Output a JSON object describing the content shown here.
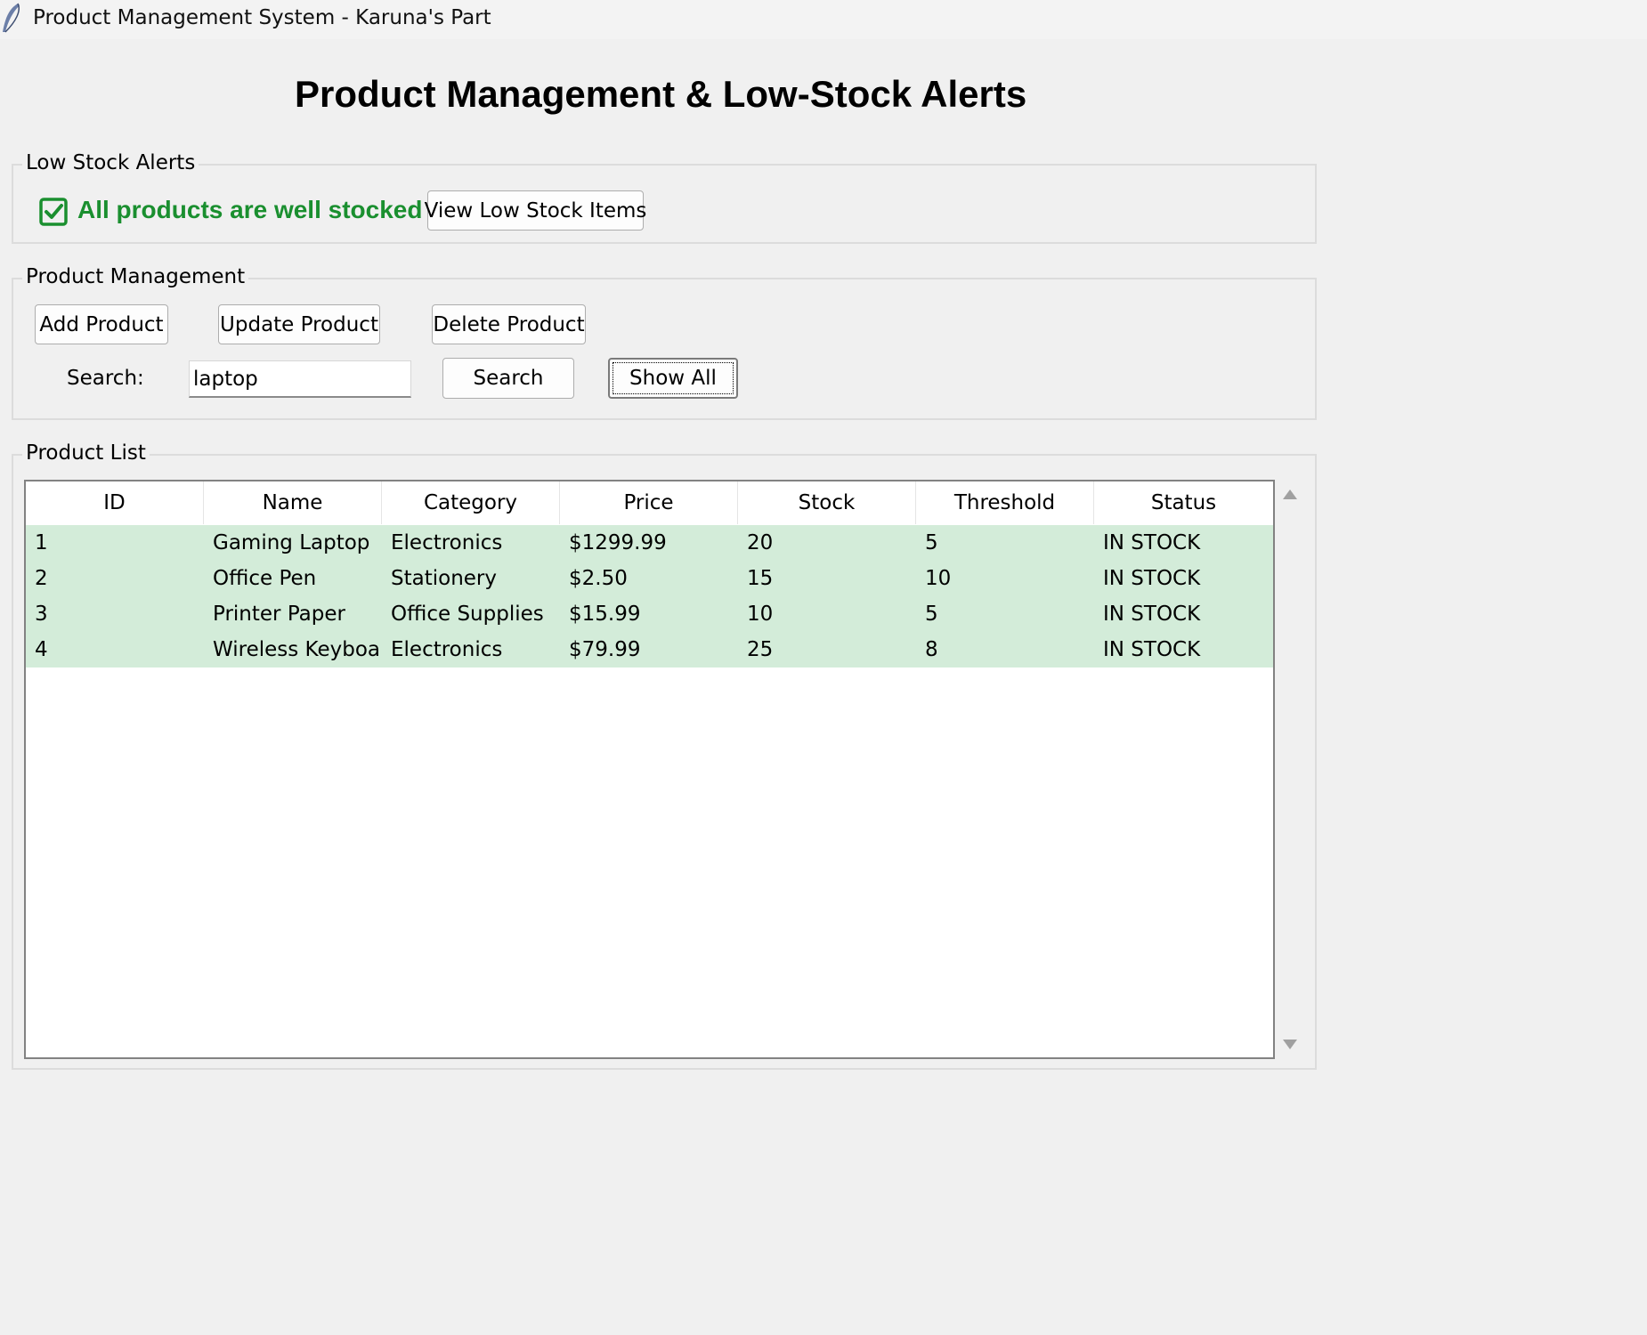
{
  "window": {
    "title": "Product Management System - Karuna's Part",
    "icon": "feather-icon"
  },
  "heading": "Product Management & Low-Stock Alerts",
  "low_stock": {
    "legend": "Low Stock Alerts",
    "status_icon": "check-box-icon",
    "status_text": "All products are well stocked",
    "status_color": "#1a8f2f",
    "view_button": "View Low Stock Items"
  },
  "management": {
    "legend": "Product Management",
    "add_button": "Add Product",
    "update_button": "Update Product",
    "delete_button": "Delete Product",
    "search_label": "Search:",
    "search_value": "laptop",
    "search_button": "Search",
    "show_all_button": "Show All"
  },
  "product_list": {
    "legend": "Product List",
    "columns": [
      "ID",
      "Name",
      "Category",
      "Price",
      "Stock",
      "Threshold",
      "Status"
    ],
    "rows": [
      [
        "1",
        "Gaming Laptop",
        "Electronics",
        "$1299.99",
        "20",
        "5",
        "IN STOCK"
      ],
      [
        "2",
        "Office Pen",
        "Stationery",
        "$2.50",
        "15",
        "10",
        "IN STOCK"
      ],
      [
        "3",
        "Printer Paper",
        "Office Supplies",
        "$15.99",
        "10",
        "5",
        "IN STOCK"
      ],
      [
        "4",
        "Wireless Keyboard",
        "Electronics",
        "$79.99",
        "25",
        "8",
        "IN STOCK"
      ]
    ],
    "row_color": "#d3ecd9"
  }
}
